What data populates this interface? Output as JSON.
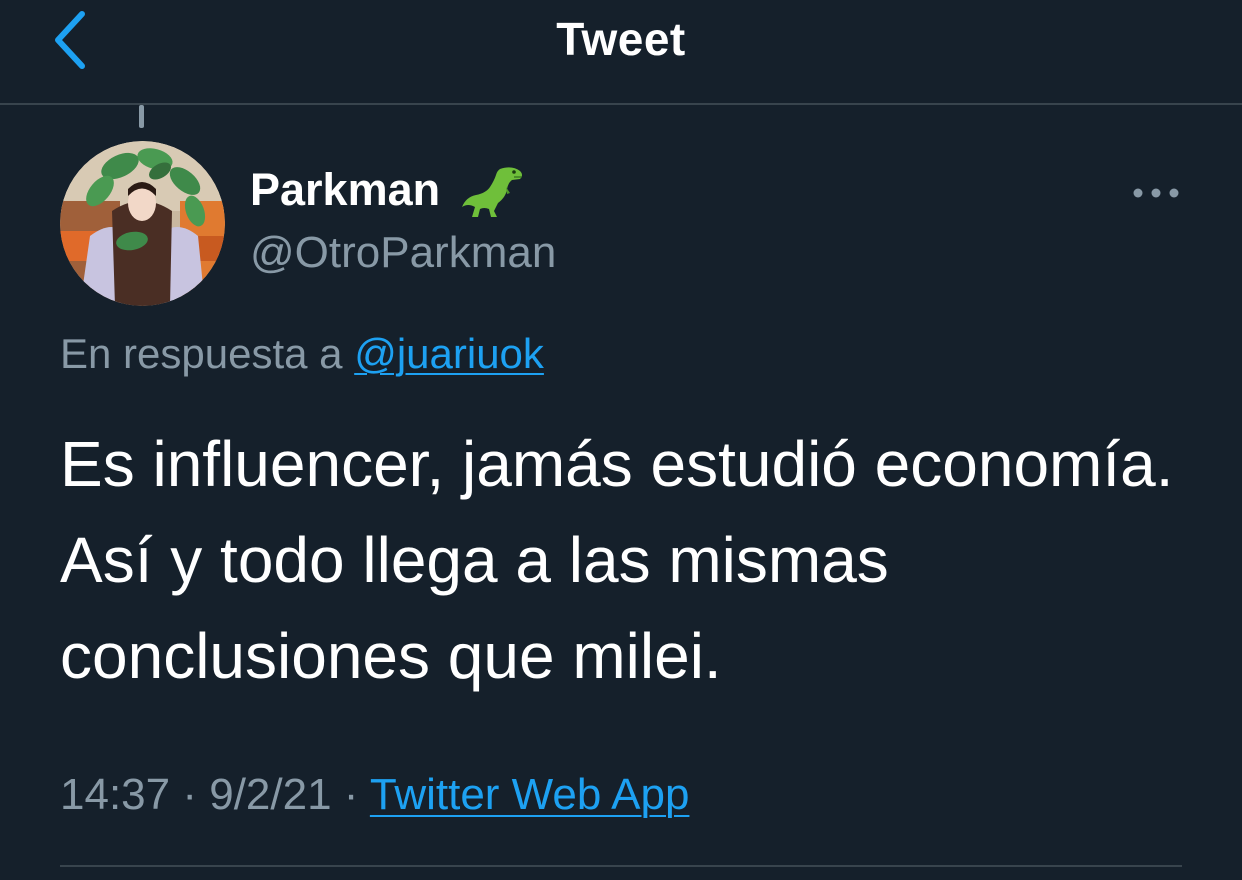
{
  "header": {
    "title": "Tweet",
    "back_icon": "chevron-left-icon"
  },
  "author": {
    "display_name": "Parkman",
    "emoji": "🦖",
    "handle": "@OtroParkman"
  },
  "reply": {
    "prefix": "En respuesta a ",
    "mention": "@juariuok"
  },
  "tweet": {
    "lines": [
      "Es influencer, jamás estudió economía.",
      "Así y todo llega a las mismas",
      "conclusiones que milei."
    ]
  },
  "meta": {
    "time": "14:37",
    "separator": " · ",
    "date": "9/2/21",
    "source": "Twitter Web App"
  },
  "colors": {
    "background": "#15202b",
    "accent": "#1da1f2",
    "secondary_text": "#8899a6",
    "divider": "#38444d"
  }
}
